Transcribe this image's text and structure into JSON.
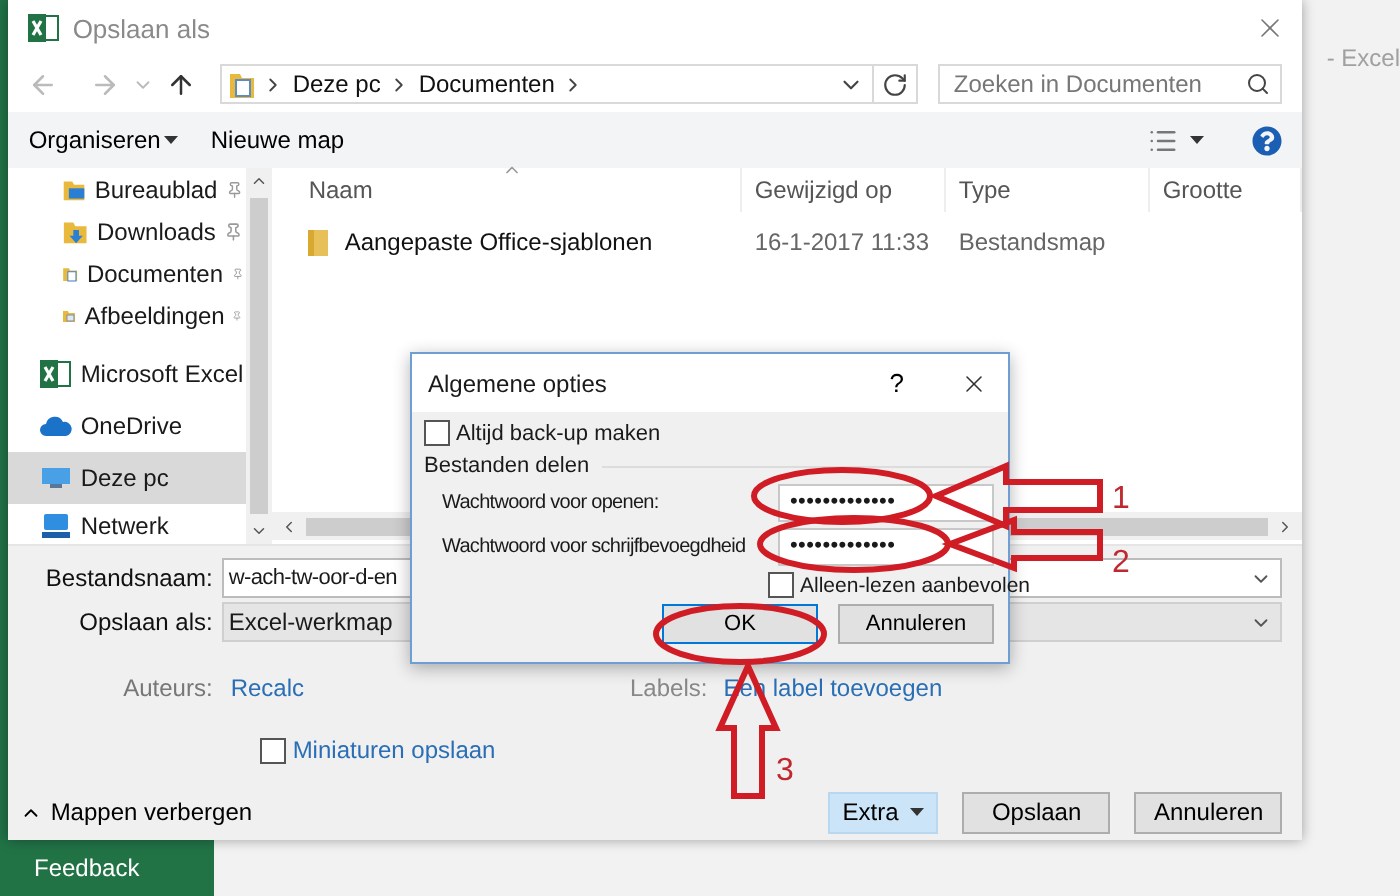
{
  "app_title": "- Excel",
  "window": {
    "title": "Opslaan als"
  },
  "address": {
    "path": [
      "Deze pc",
      "Documenten"
    ]
  },
  "search": {
    "placeholder": "Zoeken in Documenten"
  },
  "commands": [
    {
      "label": "Organiseren",
      "dropdown": true
    },
    {
      "label": "Nieuwe map",
      "dropdown": false
    }
  ],
  "nav_items": [
    {
      "label": "Bureaublad",
      "kind": "desktop",
      "pinned": true,
      "selected": false
    },
    {
      "label": "Downloads",
      "kind": "downloads",
      "pinned": true,
      "selected": false
    },
    {
      "label": "Documenten",
      "kind": "documents",
      "pinned": true,
      "selected": false
    },
    {
      "label": "Afbeeldingen",
      "kind": "pictures",
      "pinned": true,
      "selected": false
    },
    {
      "label": "Microsoft Excel",
      "kind": "excel",
      "pinned": false,
      "selected": false
    },
    {
      "label": "OneDrive",
      "kind": "cloud",
      "pinned": false,
      "selected": false
    },
    {
      "label": "Deze pc",
      "kind": "computer",
      "pinned": false,
      "selected": true
    },
    {
      "label": "Netwerk",
      "kind": "network",
      "pinned": false,
      "selected": false
    }
  ],
  "file_list": {
    "columns": [
      "Naam",
      "Gewijzigd op",
      "Type",
      "Grootte"
    ],
    "rows": [
      {
        "cells": [
          "Aangepaste Office-sjablonen",
          "16-1-2017 11:33",
          "Bestandsmap"
        ]
      }
    ]
  },
  "form": {
    "filename_label": "Bestandsnaam:",
    "filename": "w-ach-tw-oor-d-en",
    "type_label": "Opslaan als:",
    "type": "Excel-werkmap",
    "authors_label": "Auteurs:",
    "authors": "Recalc",
    "tags_label": "Labels:",
    "tags": "Een label toevoegen",
    "thumbnail": {
      "label": "Miniaturen opslaan",
      "checked": false
    }
  },
  "hide_folders": "Mappen verbergen",
  "buttons": [
    {
      "label": "Extra",
      "highlighted": true,
      "dropdown": true
    },
    {
      "label": "Opslaan",
      "highlighted": false,
      "dropdown": false
    },
    {
      "label": "Annuleren",
      "highlighted": false,
      "dropdown": false
    }
  ],
  "options_dialog": {
    "title": "Algemene opties",
    "help": "?",
    "backup": {
      "label": "Altijd back-up maken",
      "checked": false
    },
    "group": "Bestanden delen",
    "fields": [
      {
        "label": "Wachtwoord voor openen:",
        "value": "•••••••••••••"
      },
      {
        "label": "Wachtwoord voor schrijfbevoegdheid",
        "value": "•••••••••••••"
      }
    ],
    "readonly": {
      "label": "Alleen-lezen aanbevolen",
      "checked": false
    },
    "buttons": [
      {
        "label": "OK",
        "default": true
      },
      {
        "label": "Annuleren",
        "default": false
      }
    ]
  },
  "annotations": [
    "1",
    "2",
    "3"
  ],
  "feedback": "Feedback"
}
